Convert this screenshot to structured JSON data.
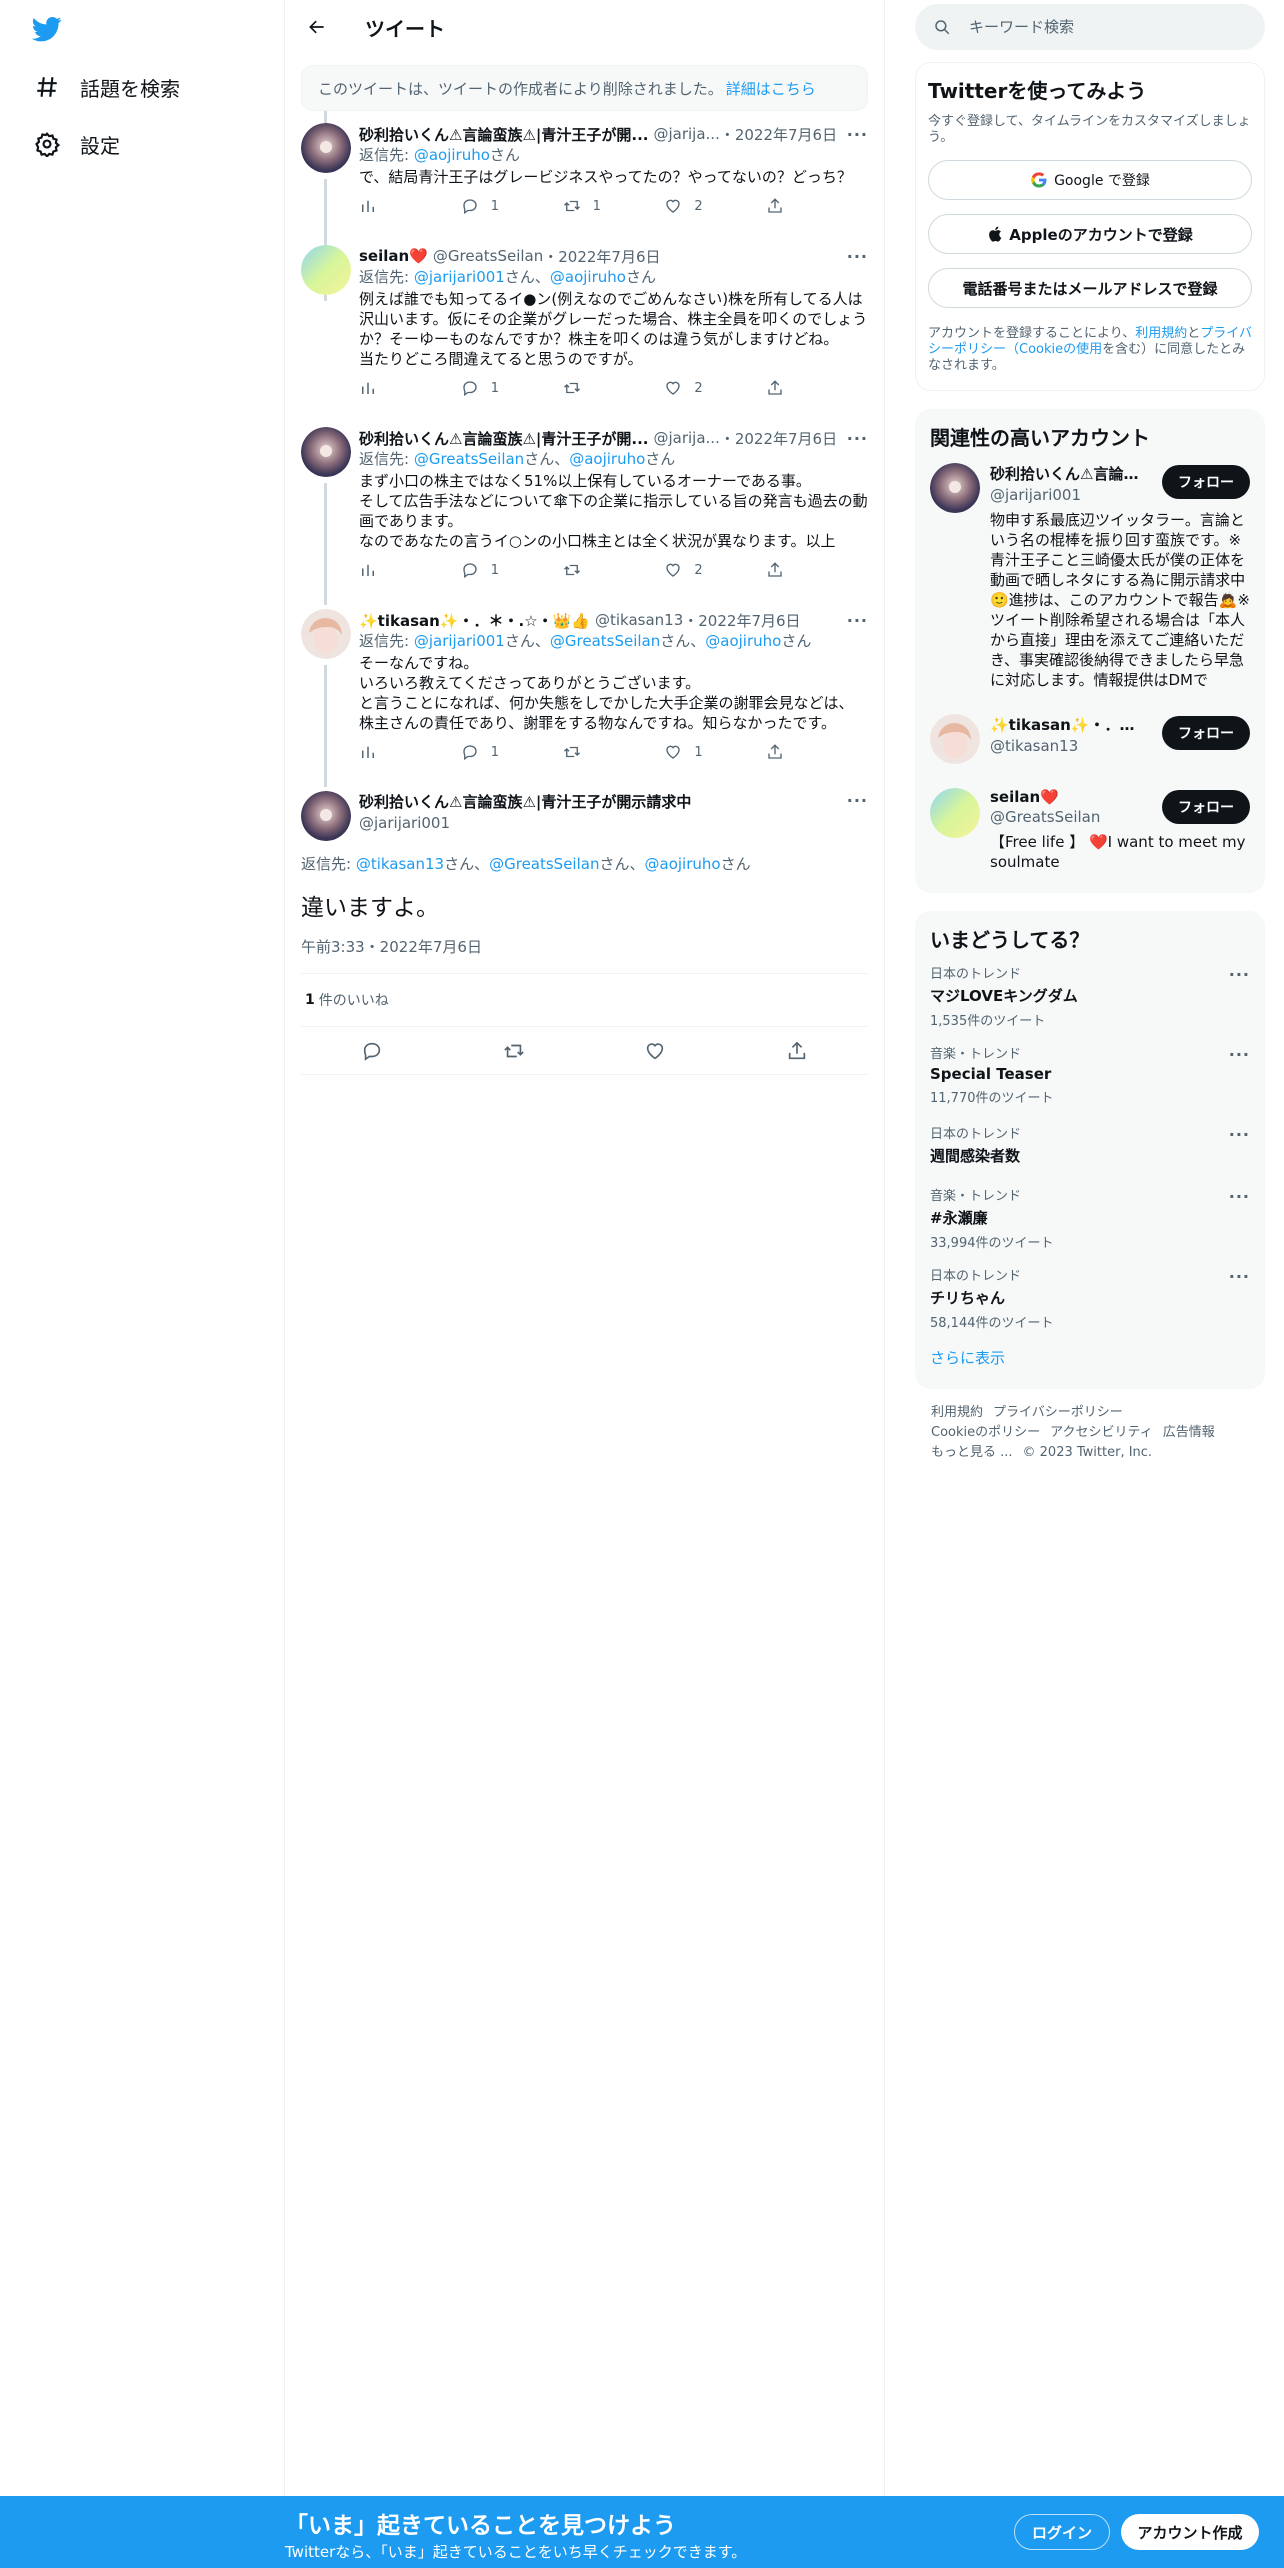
{
  "nav": {
    "items": [
      {
        "label": "話題を検索"
      },
      {
        "label": "設定"
      }
    ]
  },
  "header": {
    "title": "ツイート"
  },
  "deleted_notice": {
    "text": "このツイートは、ツイートの作成者により削除されました。",
    "link": "詳細はこちら"
  },
  "tweets": [
    {
      "name": "砂利拾いくん⚠言論蛮族⚠|青汁王子が開...",
      "handle": "@jarija...",
      "date": "・2022年7月6日",
      "reply_prefix": "返信先: ",
      "reply_mentions": [
        "@aojiruho"
      ],
      "reply_suffix": "さん",
      "text": "で、結局青汁王子はグレービジネスやってたの？やってないの？どっち？",
      "replies": "1",
      "retweets": "1",
      "likes": "2"
    },
    {
      "name": "seilan❤️",
      "handle": "@GreatsSeilan",
      "date": "・2022年7月6日",
      "reply_prefix": "返信先: ",
      "reply_mentions": [
        "@jarijari001",
        "@aojiruho"
      ],
      "reply_suffix": "さん",
      "text": "例えば誰でも知ってるイ●ン(例えなのでごめんなさい)株を所有してる人は沢山います。仮にその企業がグレーだった場合、株主全員を叩くのでしょうか？そーゆーものなんですか？株主を叩くのは違う気がしますけどね。\n当たりどころ間違えてると思うのですが。",
      "replies": "1",
      "retweets": "",
      "likes": "2"
    },
    {
      "name": "砂利拾いくん⚠言論蛮族⚠|青汁王子が開...",
      "handle": "@jarija...",
      "date": "・2022年7月6日",
      "reply_prefix": "返信先: ",
      "reply_mentions": [
        "@GreatsSeilan",
        "@aojiruho"
      ],
      "reply_suffix": "さん",
      "text": "まず小口の株主ではなく51%以上保有しているオーナーである事。\nそして広告手法などについて傘下の企業に指示している旨の発言も過去の動画であります。\nなのであなたの言うイ○ンの小口株主とは全く状況が異なります。以上",
      "replies": "1",
      "retweets": "",
      "likes": "2"
    },
    {
      "name": "✨tikasan✨・．＊・.☆・👑👍",
      "handle": "@tikasan13",
      "date": "・2022年7月6日",
      "reply_prefix": "返信先: ",
      "reply_mentions": [
        "@jarijari001",
        "@GreatsSeilan",
        "@aojiruho"
      ],
      "reply_suffix": "さん",
      "text": "そーなんですね。\nいろいろ教えてくださってありがとうございます。\nと言うことになれば、何か失態をしでかした大手企業の謝罪会見などは、株主さんの責任であり、謝罪をする物なんですね。知らなかったです。",
      "replies": "1",
      "retweets": "",
      "likes": "1"
    }
  ],
  "focus_tweet": {
    "name": "砂利拾いくん⚠言論蛮族⚠|青汁王子が開示請求中",
    "handle": "@jarijari001",
    "reply_prefix": "返信先: ",
    "reply_mentions": [
      "@tikasan13",
      "@GreatsSeilan",
      "@aojiruho"
    ],
    "reply_suffix": "さん",
    "text": "違いますよ。",
    "time": "午前3:33・2022年7月6日",
    "likes_count": "1",
    "likes_label": "件のいいね"
  },
  "search": {
    "placeholder": "キーワード検索"
  },
  "signup": {
    "title": "Twitterを使ってみよう",
    "subtitle": "今すぐ登録して、タイムラインをカスタマイズしましょう。",
    "google": "Google で登録",
    "apple": "Appleのアカウントで登録",
    "phone": "電話番号またはメールアドレスで登録",
    "terms_prefix": "アカウントを登録することにより、",
    "terms_link1": "利用規約",
    "terms_and": "と",
    "terms_link2": "プライバシーポリシー（Cookieの使用",
    "terms_suffix": "を含む）に同意したとみなされます。"
  },
  "related": {
    "title": "関連性の高いアカウント",
    "follow_label": "フォロー",
    "users": [
      {
        "name": "砂利拾いくん⚠言論...",
        "handle": "@jarijari001",
        "bio": "物申す系最底辺ツイッタラー。言論という名の棍棒を振り回す蛮族です。※青汁王子こと三崎優太氏が僕の正体を動画で晒しネタにする為に開示請求中🙂進捗は、このアカウントで報告🙇※ツイート削除希望される場合は「本人から直接」理由を添えてご連絡いただき、事実確認後納得できましたら早急に対応します。情報提供はDMで"
      },
      {
        "name": "✨tikasan✨・．＊・...",
        "handle": "@tikasan13",
        "bio": ""
      },
      {
        "name": "seilan❤️",
        "handle": "@GreatsSeilan",
        "bio": "【Free life 】 ❤️I want to meet my soulmate"
      }
    ]
  },
  "trends": {
    "title": "いまどうしてる？",
    "items": [
      {
        "meta": "日本のトレンド",
        "name": "マジLOVEキングダム",
        "count": "1,535件のツイート"
      },
      {
        "meta": "音楽・トレンド",
        "name": "Special Teaser",
        "count": "11,770件のツイート"
      },
      {
        "meta": "日本のトレンド",
        "name": "週間感染者数",
        "count": ""
      },
      {
        "meta": "音楽・トレンド",
        "name": "#永瀬廉",
        "count": "33,994件のツイート"
      },
      {
        "meta": "日本のトレンド",
        "name": "チリちゃん",
        "count": "58,144件のツイート"
      }
    ],
    "show_more": "さらに表示"
  },
  "footer": {
    "links": [
      "利用規約",
      "プライバシーポリシー",
      "Cookieのポリシー",
      "アクセシビリティ",
      "広告情報",
      "もっと見る ..."
    ],
    "copyright": "© 2023 Twitter, Inc."
  },
  "bottom_bar": {
    "title": "「いま」起きていることを見つけよう",
    "subtitle": "Twitterなら、「いま」起きていることをいち早くチェックできます。",
    "login": "ログイン",
    "signup": "アカウント作成"
  },
  "colors": {
    "accent": "#1d9bf0",
    "text": "#0f1419",
    "muted": "#536471"
  }
}
